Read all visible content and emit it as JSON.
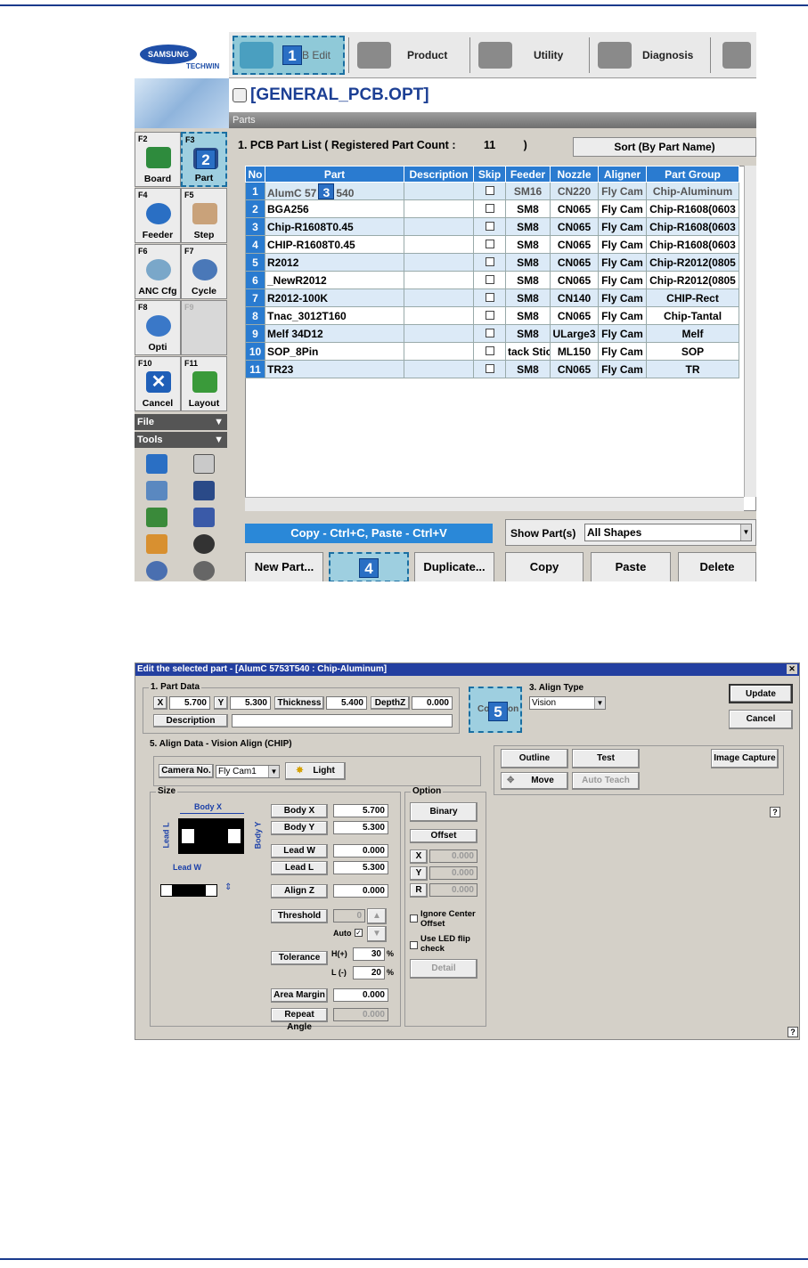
{
  "screen1": {
    "logo": {
      "brand": "SAMSUNG",
      "sub": "TECHWIN"
    },
    "topbar": [
      {
        "badge": "1",
        "label": "B Edit"
      },
      {
        "label": "Product"
      },
      {
        "label": "Utility"
      },
      {
        "label": "Diagnosis"
      }
    ],
    "file_title": "[GENERAL_PCB.OPT]",
    "sidebar": {
      "keys": [
        {
          "key": "F2",
          "label": "Board"
        },
        {
          "key": "F3",
          "label": "Part",
          "badge": "2"
        },
        {
          "key": "F4",
          "label": "Feeder"
        },
        {
          "key": "F5",
          "label": "Step"
        },
        {
          "key": "F6",
          "label": "ANC Cfg"
        },
        {
          "key": "F7",
          "label": "Cycle"
        },
        {
          "key": "F8",
          "label": "Opti"
        },
        {
          "key": "F9",
          "label": ""
        },
        {
          "key": "F10",
          "label": "Cancel"
        },
        {
          "key": "F11",
          "label": "Layout"
        }
      ],
      "menus": [
        "File",
        "Tools"
      ]
    },
    "parts_header": "Parts",
    "list_title": "1. PCB Part List  ( Registered Part Count :",
    "part_count": "11",
    "list_title_close": ")",
    "sort_button": "Sort (By Part Name)",
    "columns": [
      "No",
      "Part",
      "Description",
      "Skip",
      "Feeder",
      "Nozzle",
      "Aligner",
      "Part Group"
    ],
    "rows": [
      [
        "1",
        "AlumC 57",
        "",
        "",
        "SM16",
        "CN220",
        "Fly Cam",
        "Chip-Aluminum"
      ],
      [
        "2",
        "BGA256",
        "",
        "",
        "SM8",
        "CN065",
        "Fly Cam",
        "Chip-R1608(0603"
      ],
      [
        "3",
        "Chip-R1608T0.45",
        "",
        "",
        "SM8",
        "CN065",
        "Fly Cam",
        "Chip-R1608(0603"
      ],
      [
        "4",
        "CHIP-R1608T0.45",
        "",
        "",
        "SM8",
        "CN065",
        "Fly Cam",
        "Chip-R1608(0603"
      ],
      [
        "5",
        "R2012",
        "",
        "",
        "SM8",
        "CN065",
        "Fly Cam",
        "Chip-R2012(0805"
      ],
      [
        "6",
        "_NewR2012",
        "",
        "",
        "SM8",
        "CN065",
        "Fly Cam",
        "Chip-R2012(0805"
      ],
      [
        "7",
        "R2012-100K",
        "",
        "",
        "SM8",
        "CN140",
        "Fly Cam",
        "CHIP-Rect"
      ],
      [
        "8",
        "Tnac_3012T160",
        "",
        "",
        "SM8",
        "CN065",
        "Fly Cam",
        "Chip-Tantal"
      ],
      [
        "9",
        "Melf 34D12",
        "",
        "",
        "SM8",
        "ULarge3",
        "Fly Cam",
        "Melf"
      ],
      [
        "10",
        "SOP_8Pin",
        "",
        "",
        "tack Stic",
        "ML150",
        "Fly Cam",
        "SOP"
      ],
      [
        "11",
        "TR23",
        "",
        "",
        "SM8",
        "CN065",
        "Fly Cam",
        "TR"
      ]
    ],
    "row1_suffix": "540",
    "row1_badge": "3",
    "copy_hint": "Copy - Ctrl+C,  Paste - Ctrl+V",
    "show_label": "Show Part(s)",
    "show_value": "All Shapes",
    "buttons": [
      "New Part...",
      "E",
      "Duplicate...",
      "Copy",
      "Paste",
      "Delete"
    ],
    "edit_badge": "4"
  },
  "screen2": {
    "title": "Edit the selected part - [AlumC 5753T540 : Chip-Aluminum]",
    "part_data": {
      "label": "1. Part Data",
      "x_label": "X",
      "x": "5.700",
      "y_label": "Y",
      "y": "5.300",
      "thickness_label": "Thickness",
      "thickness": "5.400",
      "depth_label": "DepthZ",
      "depth": "0.000",
      "description_label": "Description"
    },
    "common_button": {
      "left": "Co",
      "right": "on",
      "badge": "5"
    },
    "align_type": {
      "label": "3. Align Type",
      "value": "Vision"
    },
    "update": "Update",
    "cancel": "Cancel",
    "align_data": {
      "label": "5. Align Data - Vision Align (CHIP)",
      "camera_label": "Camera No.",
      "camera_value": "Fly Cam1",
      "light": "Light"
    },
    "right_buttons": {
      "outline": "Outline",
      "test": "Test",
      "image_capture": "Image Capture",
      "move": "Move",
      "auto_teach": "Auto Teach"
    },
    "size": {
      "label": "Size",
      "diagram": {
        "body_x": "Body X",
        "body_y": "Body Y",
        "lead_l": "Lead L",
        "lead_w": "Lead W"
      },
      "fields": [
        {
          "label": "Body X",
          "value": "5.700"
        },
        {
          "label": "Body Y",
          "value": "5.300"
        },
        {
          "label": "Lead W",
          "value": "0.000"
        },
        {
          "label": "Lead L",
          "value": "5.300"
        },
        {
          "label": "Align Z",
          "value": "0.000"
        }
      ],
      "threshold_label": "Threshold",
      "threshold_value": "0",
      "auto_label": "Auto",
      "tolerance_label": "Tolerance",
      "tol_h_label": "H(+)",
      "tol_h": "30",
      "tol_l_label": "L (-)",
      "tol_l": "20",
      "percent": "%",
      "area_margin_label": "Area Margin",
      "area_margin": "0.000",
      "repeat_angle_label": "Repeat Angle",
      "repeat_angle": "0.000"
    },
    "option": {
      "label": "Option",
      "binary": "Binary",
      "offset": "Offset",
      "x_label": "X",
      "x": "0.000",
      "y_label": "Y",
      "y": "0.000",
      "r_label": "R",
      "r": "0.000",
      "ignore_center": "Ignore Center Offset",
      "use_led": "Use LED flip check",
      "detail": "Detail"
    },
    "help": "?"
  }
}
